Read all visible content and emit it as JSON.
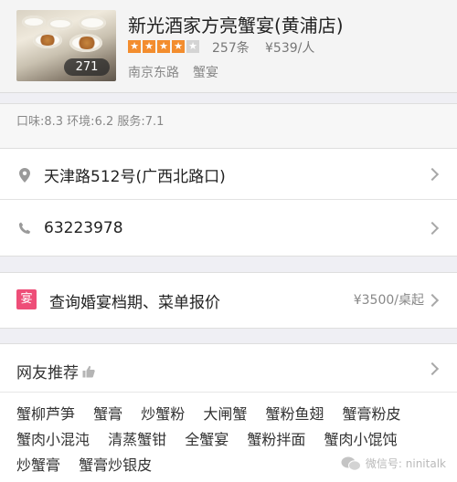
{
  "shop": {
    "photo_count": "271",
    "name": "新光酒家方亮蟹宴(黄浦店)",
    "rating_stars": 4,
    "rating_max": 5,
    "reviews": "257条",
    "price": "¥539/人",
    "area": "南京东路",
    "category": "蟹宴"
  },
  "scores": "口味:8.3 环境:6.2 服务:7.1",
  "address": "天津路512号(广西北路口)",
  "phone": "63223978",
  "banquet": {
    "icon_char": "宴",
    "label": "查询婚宴档期、菜单报价",
    "price": "¥3500/桌起"
  },
  "recommend": {
    "title": "网友推荐",
    "dishes": [
      "蟹柳芦笋",
      "蟹膏",
      "炒蟹粉",
      "大闸蟹",
      "蟹粉鱼翅",
      "蟹膏粉皮",
      "蟹肉小混沌",
      "清蒸蟹钳",
      "全蟹宴",
      "蟹粉拌面",
      "蟹肉小馄饨",
      "炒蟹膏",
      "蟹膏炒银皮"
    ]
  },
  "watermark": "微信号: ninitalk",
  "colors": {
    "star_on": "#f38d2e",
    "star_off": "#d4d4d4",
    "banquet_icon": "#ee4e78"
  },
  "icons": [
    "location-pin-icon",
    "phone-icon",
    "chevron-right-icon",
    "thumbs-up-icon",
    "wechat-icon"
  ]
}
